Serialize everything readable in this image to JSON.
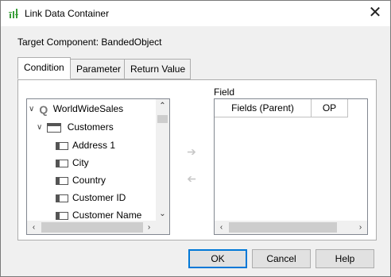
{
  "window": {
    "title": "Link Data Container",
    "close_glyph": "✕"
  },
  "target": {
    "label": "Target Component:",
    "value": "BandedObject"
  },
  "tabs": [
    {
      "label": "Condition",
      "active": true
    },
    {
      "label": "Parameter",
      "active": false
    },
    {
      "label": "Return Value",
      "active": false
    }
  ],
  "tree": {
    "root": "WorldWideSales",
    "table": "Customers",
    "columns": [
      "Address 1",
      "City",
      "Country",
      "Customer ID",
      "Customer Name"
    ]
  },
  "field": {
    "label": "Field",
    "columns": [
      "Fields (Parent)",
      "OP"
    ]
  },
  "buttons": {
    "ok": "OK",
    "cancel": "Cancel",
    "help": "Help"
  },
  "colors": {
    "accent": "#0078d7",
    "icon_green": "#3a9f3a"
  }
}
